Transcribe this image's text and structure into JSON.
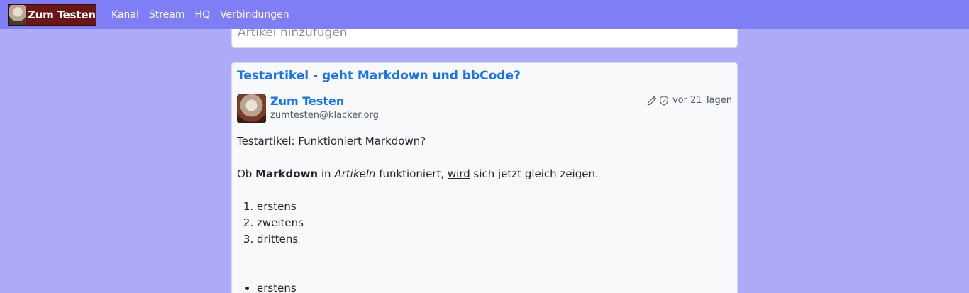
{
  "navbar": {
    "brand": "Zum Testen",
    "links": [
      "Kanal",
      "Stream",
      "HQ",
      "Verbindungen"
    ]
  },
  "composer": {
    "placeholder": "Artikel hinzufügen"
  },
  "article": {
    "title": "Testartikel - geht Markdown und bbCode?",
    "author_name": "Zum Testen",
    "author_address": "zumtesten@klacker.org",
    "time": "vor 21 Tagen",
    "intro": "Testartikel: Funktioniert Markdown?",
    "sentence": {
      "p1": "Ob ",
      "bold": "Markdown",
      "p2": " in ",
      "italic": "Artikeln",
      "p3": " funktioniert, ",
      "underline": "wird",
      "p4": " sich jetzt gleich zeigen."
    },
    "ordered_list": [
      "erstens",
      "zweitens",
      "drittens"
    ],
    "bullet_list": [
      "erstens"
    ]
  },
  "colors": {
    "background": "#adabf8",
    "navbar": "#7f7ef4",
    "link": "#1a73e8"
  },
  "icons": [
    "pencil-icon",
    "shield-icon"
  ]
}
